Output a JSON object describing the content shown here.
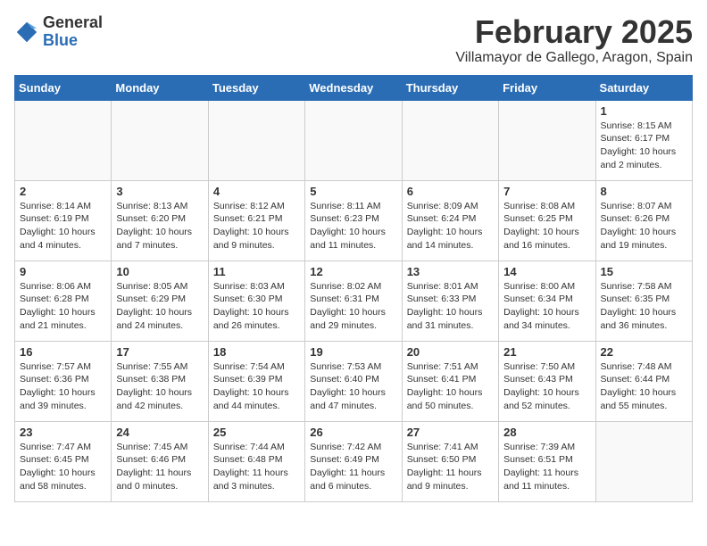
{
  "header": {
    "logo_general": "General",
    "logo_blue": "Blue",
    "month_year": "February 2025",
    "location": "Villamayor de Gallego, Aragon, Spain"
  },
  "weekdays": [
    "Sunday",
    "Monday",
    "Tuesday",
    "Wednesday",
    "Thursday",
    "Friday",
    "Saturday"
  ],
  "weeks": [
    [
      {
        "day": "",
        "info": ""
      },
      {
        "day": "",
        "info": ""
      },
      {
        "day": "",
        "info": ""
      },
      {
        "day": "",
        "info": ""
      },
      {
        "day": "",
        "info": ""
      },
      {
        "day": "",
        "info": ""
      },
      {
        "day": "1",
        "info": "Sunrise: 8:15 AM\nSunset: 6:17 PM\nDaylight: 10 hours\nand 2 minutes."
      }
    ],
    [
      {
        "day": "2",
        "info": "Sunrise: 8:14 AM\nSunset: 6:19 PM\nDaylight: 10 hours\nand 4 minutes."
      },
      {
        "day": "3",
        "info": "Sunrise: 8:13 AM\nSunset: 6:20 PM\nDaylight: 10 hours\nand 7 minutes."
      },
      {
        "day": "4",
        "info": "Sunrise: 8:12 AM\nSunset: 6:21 PM\nDaylight: 10 hours\nand 9 minutes."
      },
      {
        "day": "5",
        "info": "Sunrise: 8:11 AM\nSunset: 6:23 PM\nDaylight: 10 hours\nand 11 minutes."
      },
      {
        "day": "6",
        "info": "Sunrise: 8:09 AM\nSunset: 6:24 PM\nDaylight: 10 hours\nand 14 minutes."
      },
      {
        "day": "7",
        "info": "Sunrise: 8:08 AM\nSunset: 6:25 PM\nDaylight: 10 hours\nand 16 minutes."
      },
      {
        "day": "8",
        "info": "Sunrise: 8:07 AM\nSunset: 6:26 PM\nDaylight: 10 hours\nand 19 minutes."
      }
    ],
    [
      {
        "day": "9",
        "info": "Sunrise: 8:06 AM\nSunset: 6:28 PM\nDaylight: 10 hours\nand 21 minutes."
      },
      {
        "day": "10",
        "info": "Sunrise: 8:05 AM\nSunset: 6:29 PM\nDaylight: 10 hours\nand 24 minutes."
      },
      {
        "day": "11",
        "info": "Sunrise: 8:03 AM\nSunset: 6:30 PM\nDaylight: 10 hours\nand 26 minutes."
      },
      {
        "day": "12",
        "info": "Sunrise: 8:02 AM\nSunset: 6:31 PM\nDaylight: 10 hours\nand 29 minutes."
      },
      {
        "day": "13",
        "info": "Sunrise: 8:01 AM\nSunset: 6:33 PM\nDaylight: 10 hours\nand 31 minutes."
      },
      {
        "day": "14",
        "info": "Sunrise: 8:00 AM\nSunset: 6:34 PM\nDaylight: 10 hours\nand 34 minutes."
      },
      {
        "day": "15",
        "info": "Sunrise: 7:58 AM\nSunset: 6:35 PM\nDaylight: 10 hours\nand 36 minutes."
      }
    ],
    [
      {
        "day": "16",
        "info": "Sunrise: 7:57 AM\nSunset: 6:36 PM\nDaylight: 10 hours\nand 39 minutes."
      },
      {
        "day": "17",
        "info": "Sunrise: 7:55 AM\nSunset: 6:38 PM\nDaylight: 10 hours\nand 42 minutes."
      },
      {
        "day": "18",
        "info": "Sunrise: 7:54 AM\nSunset: 6:39 PM\nDaylight: 10 hours\nand 44 minutes."
      },
      {
        "day": "19",
        "info": "Sunrise: 7:53 AM\nSunset: 6:40 PM\nDaylight: 10 hours\nand 47 minutes."
      },
      {
        "day": "20",
        "info": "Sunrise: 7:51 AM\nSunset: 6:41 PM\nDaylight: 10 hours\nand 50 minutes."
      },
      {
        "day": "21",
        "info": "Sunrise: 7:50 AM\nSunset: 6:43 PM\nDaylight: 10 hours\nand 52 minutes."
      },
      {
        "day": "22",
        "info": "Sunrise: 7:48 AM\nSunset: 6:44 PM\nDaylight: 10 hours\nand 55 minutes."
      }
    ],
    [
      {
        "day": "23",
        "info": "Sunrise: 7:47 AM\nSunset: 6:45 PM\nDaylight: 10 hours\nand 58 minutes."
      },
      {
        "day": "24",
        "info": "Sunrise: 7:45 AM\nSunset: 6:46 PM\nDaylight: 11 hours\nand 0 minutes."
      },
      {
        "day": "25",
        "info": "Sunrise: 7:44 AM\nSunset: 6:48 PM\nDaylight: 11 hours\nand 3 minutes."
      },
      {
        "day": "26",
        "info": "Sunrise: 7:42 AM\nSunset: 6:49 PM\nDaylight: 11 hours\nand 6 minutes."
      },
      {
        "day": "27",
        "info": "Sunrise: 7:41 AM\nSunset: 6:50 PM\nDaylight: 11 hours\nand 9 minutes."
      },
      {
        "day": "28",
        "info": "Sunrise: 7:39 AM\nSunset: 6:51 PM\nDaylight: 11 hours\nand 11 minutes."
      },
      {
        "day": "",
        "info": ""
      }
    ]
  ]
}
